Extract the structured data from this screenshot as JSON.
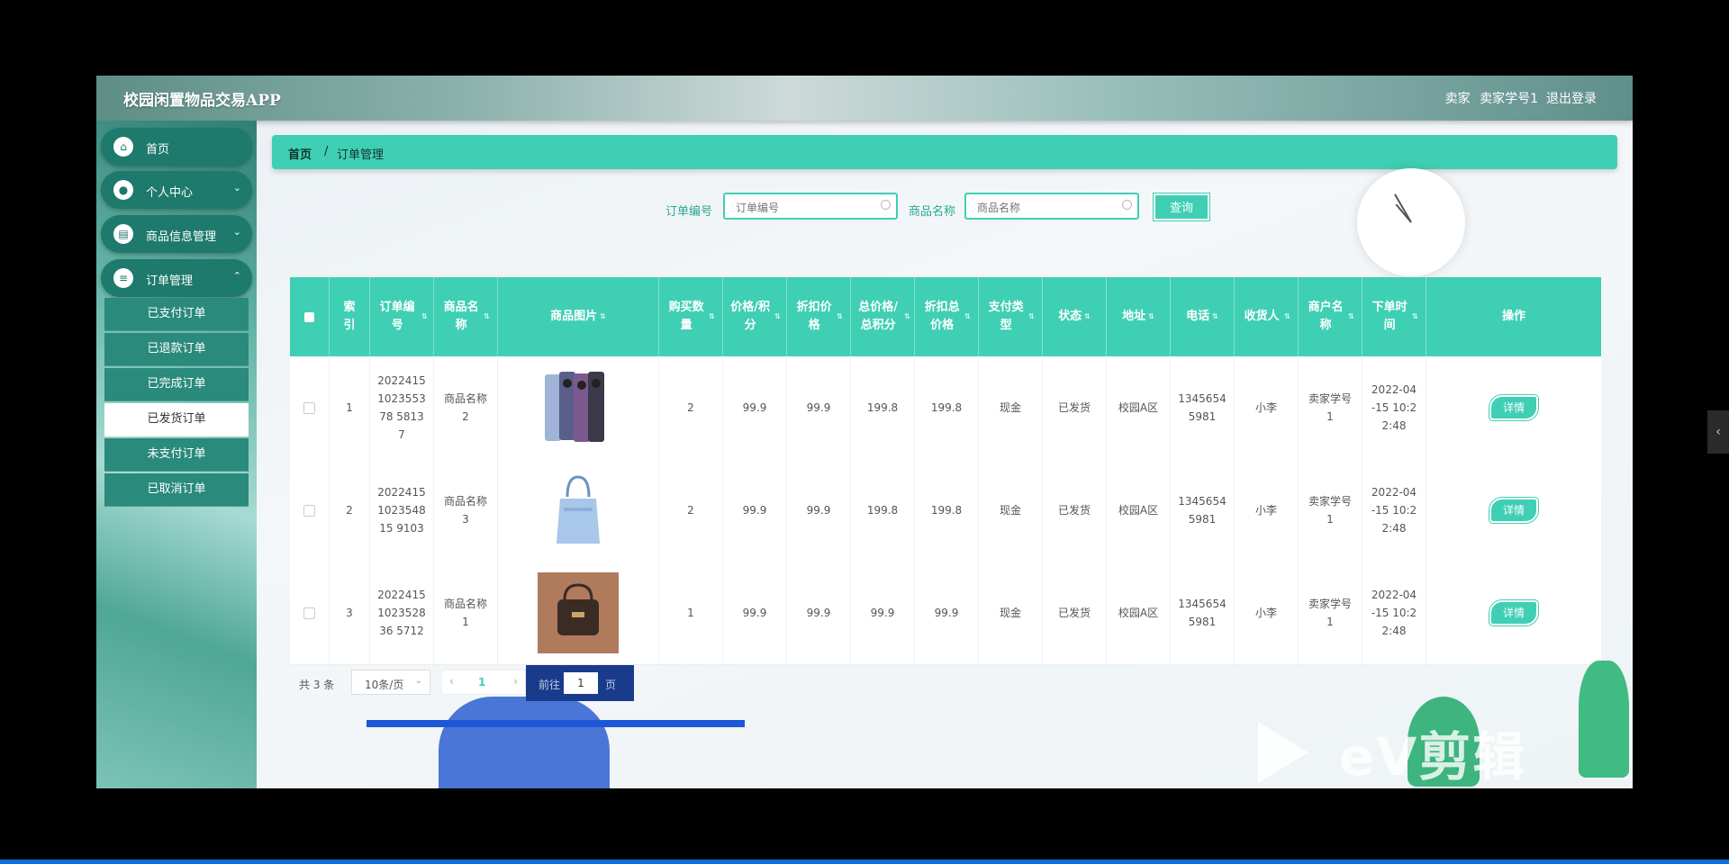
{
  "header": {
    "title": "校园闲置物品交易APP",
    "role": "卖家",
    "username": "卖家学号1",
    "logout": "退出登录"
  },
  "sidebar": {
    "items": [
      {
        "label": "首页",
        "icon": "home-icon"
      },
      {
        "label": "个人中心",
        "icon": "user-icon"
      },
      {
        "label": "商品信息管理",
        "icon": "chart-icon"
      },
      {
        "label": "订单管理",
        "icon": "list-icon"
      }
    ],
    "sub_items": [
      "已支付订单",
      "已退款订单",
      "已完成订单",
      "已发货订单",
      "未支付订单",
      "已取消订单"
    ],
    "active_sub": "已发货订单"
  },
  "breadcrumb": {
    "home": "首页",
    "separator": "/",
    "current": "订单管理"
  },
  "search": {
    "order_no_label": "订单编号",
    "order_no_placeholder": "订单编号",
    "product_label": "商品名称",
    "product_placeholder": "商品名称",
    "query_button": "查询"
  },
  "table": {
    "headers": [
      "索引",
      "订单编号",
      "商品名称",
      "商品图片",
      "购买数量",
      "价格/积分",
      "折扣价格",
      "总价格/总积分",
      "折扣总价格",
      "支付类型",
      "状态",
      "地址",
      "电话",
      "收货人",
      "商户名称",
      "下单时间",
      "操作"
    ],
    "rows": [
      {
        "index": "1",
        "order_no": "2022415102355378 58137",
        "product": "商品名称2",
        "image": "phone",
        "qty": "2",
        "price": "99.9",
        "discount_price": "99.9",
        "total": "199.8",
        "discount_total": "199.8",
        "pay_type": "现金",
        "status": "已发货",
        "address": "校园A区",
        "phone": "13456545981",
        "receiver": "小李",
        "merchant": "卖家学号1",
        "time": "2022-04-15 10:22:48"
      },
      {
        "index": "2",
        "order_no": "2022415102354815 9103",
        "product": "商品名称3",
        "image": "bag-blue",
        "qty": "2",
        "price": "99.9",
        "discount_price": "99.9",
        "total": "199.8",
        "discount_total": "199.8",
        "pay_type": "现金",
        "status": "已发货",
        "address": "校园A区",
        "phone": "13456545981",
        "receiver": "小李",
        "merchant": "卖家学号1",
        "time": "2022-04-15 10:22:48"
      },
      {
        "index": "3",
        "order_no": "2022415102352836 5712",
        "product": "商品名称1",
        "image": "bag-brown",
        "qty": "1",
        "price": "99.9",
        "discount_price": "99.9",
        "total": "99.9",
        "discount_total": "99.9",
        "pay_type": "现金",
        "status": "已发货",
        "address": "校园A区",
        "phone": "13456545981",
        "receiver": "小李",
        "merchant": "卖家学号1",
        "time": "2022-04-15 10:22:48"
      }
    ],
    "detail_button": "详情"
  },
  "pagination": {
    "total": "共 3 条",
    "page_size": "10条/页",
    "current_page": "1",
    "goto_prefix": "前往",
    "goto_value": "1",
    "goto_suffix": "页"
  },
  "watermark": "eV剪辑",
  "colors": {
    "accent": "#3fcfb4",
    "sidebar": "#1e7a6c"
  }
}
